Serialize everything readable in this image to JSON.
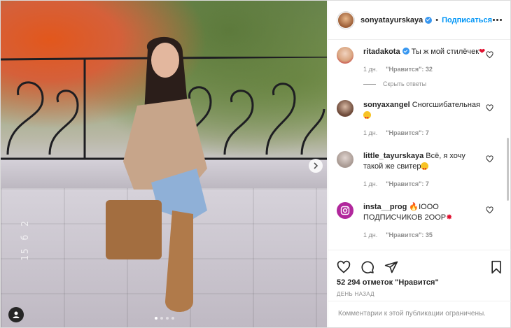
{
  "post": {
    "author": "sonyatayurskaya",
    "follow_label": "Подписаться",
    "separator": "•",
    "photo_date_stamp": "15 б 2",
    "carousel_dots": 4,
    "carousel_active": 0
  },
  "comments": [
    {
      "username": "ritadakota",
      "verified": true,
      "text": "Ты ж мой стилёчек",
      "emoji": "heart",
      "time": "1 дн.",
      "likes": "\"Нравится\": 32",
      "hide_replies": "Скрыть ответы",
      "avatar_color": "#d9a580"
    },
    {
      "username": "sonyaxangel",
      "verified": false,
      "text": "Сногсшибательная",
      "emoji": "heart-eyes",
      "time": "1 дн.",
      "likes": "\"Нравится\": 7",
      "avatar_color": "#6e4a3a"
    },
    {
      "username": "little_tayurskaya",
      "verified": false,
      "text": "Всё, я хочу такой же свитер",
      "emoji": "heart-eyes",
      "time": "1 дн.",
      "likes": "\"Нравится\": 7",
      "avatar_color": "#a99a93"
    },
    {
      "username": "insta__prog",
      "verified": false,
      "text_prefix": "",
      "text": "IOOO ПОДПИСЧИКОВ 2OOР",
      "emoji": "fire",
      "emoji_after": "collision",
      "time": "1 дн.",
      "likes": "\"Нравится\": 35",
      "avatar_color": "#b1279c"
    }
  ],
  "footer": {
    "likes": "52 294 отметок \"Нравится\"",
    "time_ago": "ДЕНЬ НАЗАД",
    "comments_closed": "Комментарии к этой публикации ограничены."
  },
  "colors": {
    "accent": "#0095f6",
    "verified": "#3897f0",
    "muted": "#8e8e8e",
    "text": "#262626"
  }
}
